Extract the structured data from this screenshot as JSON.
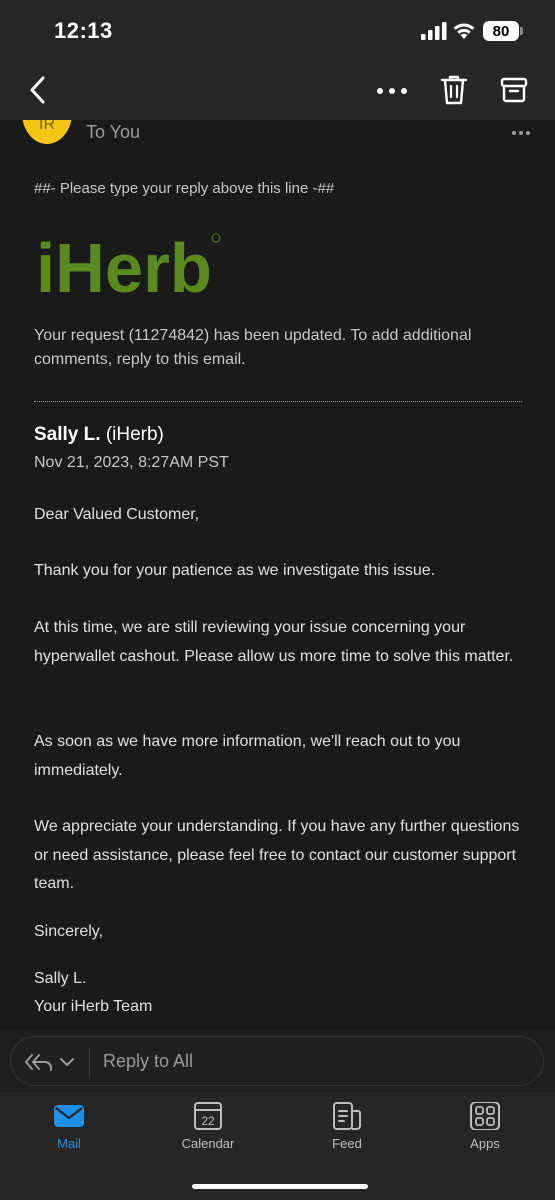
{
  "status_bar": {
    "time": "12:13",
    "battery": "80"
  },
  "header": {
    "avatar_initials": "IR",
    "recipient": "To You"
  },
  "email": {
    "reply_marker": "##- Please type your reply above this line -##",
    "logo_text": "iHerb",
    "update_notice": "Your request (11274842) has been updated. To add additional comments, reply to this email.",
    "sender_name": "Sally L.",
    "sender_org": "(iHerb)",
    "sent_date": "Nov 21, 2023, 8:27AM PST",
    "paragraphs": [
      "Dear Valued Customer,",
      "Thank you for your patience as we investigate this issue.",
      "At this time, we are still reviewing your issue concerning your hyperwallet cashout. Please allow us more time to solve this matter.",
      "As soon as we have more information, we'll reach out to you immediately.",
      "We appreciate your understanding. If you have any further questions or need assistance, please feel free to contact our customer support team.",
      "Sincerely,",
      "Sally L.",
      "Your iHerb Team"
    ]
  },
  "reply_bar": {
    "placeholder": "Reply to All"
  },
  "tabs": [
    {
      "label": "Mail",
      "icon": "mail-icon"
    },
    {
      "label": "Calendar",
      "icon": "calendar-icon",
      "badge": "22"
    },
    {
      "label": "Feed",
      "icon": "feed-icon"
    },
    {
      "label": "Apps",
      "icon": "apps-icon"
    }
  ],
  "colors": {
    "accent": "#1e8fe8",
    "brand_green": "#5a8a1f",
    "avatar_yellow": "#f5c518"
  }
}
